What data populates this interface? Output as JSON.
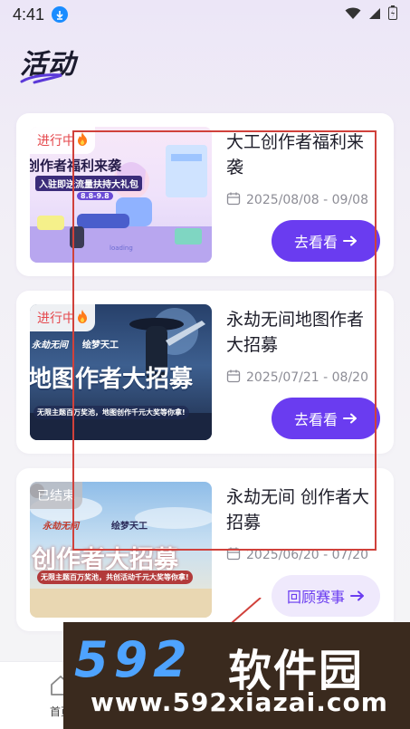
{
  "status_bar": {
    "time": "4:41"
  },
  "page": {
    "title": "活动"
  },
  "activities": [
    {
      "badge": "进行中",
      "title": "大工创作者福利来袭",
      "date": "2025/08/08 - 09/08",
      "button": "去看看",
      "thumb": {
        "line1": "创作者福利来袭",
        "line2": "入驻即送流量扶持大礼包",
        "line3": "8.8-9.8",
        "line4": "loading"
      }
    },
    {
      "badge": "进行中",
      "title": "永劫无间地图作者大招募",
      "date": "2025/07/21 - 08/20",
      "button": "去看看",
      "thumb": {
        "brand1": "永劫无间",
        "brand2": "绘梦天工",
        "line1": "地图作者大招募",
        "line2": "无限主题百万奖池，地图创作千元大奖等你拿!"
      }
    },
    {
      "badge": "已结束",
      "title": "永劫无间 创作者大招募",
      "date": "2025/06/20 - 07/20",
      "button": "回顾赛事",
      "thumb": {
        "brand1": "永劫无间",
        "brand2": "绘梦天工",
        "line1": "创作者大招募",
        "line2": "无限主题百万奖池，共创活动千元大奖等你拿!"
      }
    }
  ],
  "bottom_nav": {
    "home_label": "首页"
  },
  "watermark": {
    "logo": "592",
    "name": "软件园",
    "url": "www.592xiazai.com"
  },
  "colors": {
    "accent": "#6a3cf0",
    "live_badge": "#e5484d",
    "annotation": "#d0413b"
  }
}
